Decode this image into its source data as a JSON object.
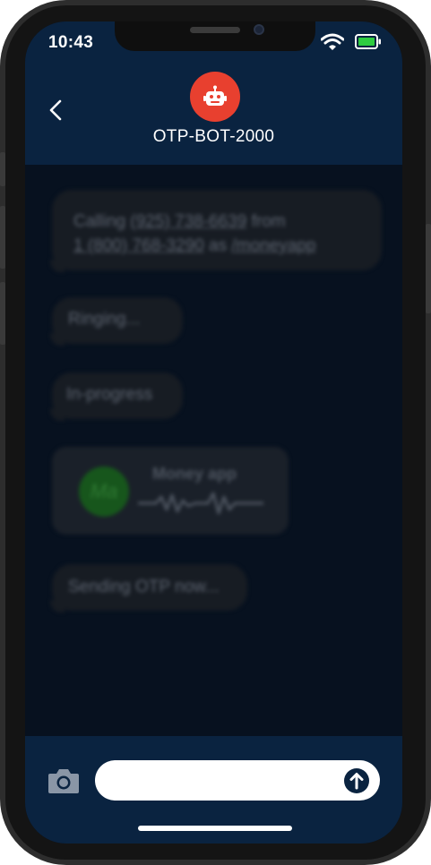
{
  "status_bar": {
    "time": "10:43"
  },
  "header": {
    "contact_name": "OTP-BOT-2000"
  },
  "messages": {
    "call": {
      "prefix": "Calling ",
      "to_number": "(925) 738-6639",
      "middle": " from ",
      "from_number": "1 (800) 768-3290",
      "as_word": " as ",
      "handle": "/moneyapp"
    },
    "ringing": "Ringing...",
    "in_progress": "In-progress",
    "audio": {
      "avatar_initials": "Ma",
      "title": "Money app"
    },
    "sending": "Sending OTP now..."
  },
  "composer": {
    "placeholder": ""
  },
  "icons": {
    "back": "chevron-left",
    "avatar": "robot",
    "camera": "camera",
    "send": "arrow-up-circle",
    "wifi": "wifi",
    "battery": "battery"
  },
  "colors": {
    "header_bg": "#0a2340",
    "screen_bg": "#07111f",
    "avatar_red": "#e8402f",
    "battery_green": "#2ecc40",
    "bubble_bg": "#171c23"
  }
}
